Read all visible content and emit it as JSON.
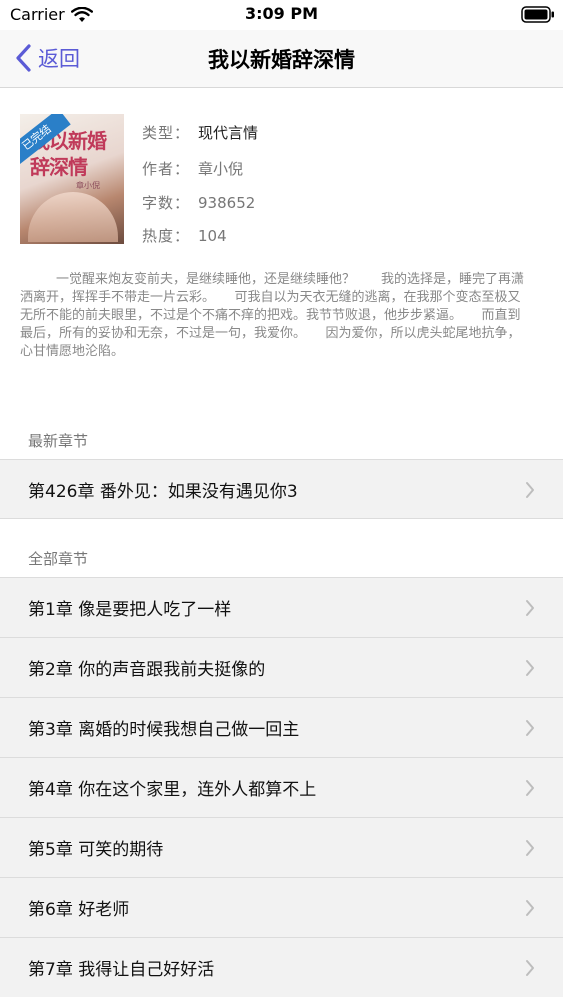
{
  "status_bar": {
    "carrier": "Carrier",
    "time": "3:09 PM"
  },
  "nav": {
    "back_label": "返回",
    "title": "我以新婚辞深情"
  },
  "book": {
    "cover_badge": "已完结",
    "cover_title": "我以新婚辞深情",
    "cover_author": "章小倪",
    "type_label": "类型：",
    "type_value": "现代言情",
    "author_label": "作者：",
    "author_value": "章小倪",
    "words_label": "字数：",
    "words_value": "938652",
    "hot_label": "热度：",
    "hot_value": "104",
    "summary": "一觉醒来炮友变前夫，是继续睡他，还是继续睡他？　　我的选择是，睡完了再潇洒离开，挥挥手不带走一片云彩。　　可我自以为天衣无缝的逃离，在我那个变态至极又无所不能的前夫眼里，不过是个不痛不痒的把戏。我节节败退，他步步紧逼。　　而直到最后，所有的妥协和无奈，不过是一句，我爱你。　　因为爱你，所以虎头蛇尾地抗争，心甘情愿地沦陷。"
  },
  "latest_section": {
    "title": "最新章节",
    "chapter": "第426章 番外见：如果没有遇见你3"
  },
  "all_section": {
    "title": "全部章节",
    "chapters": [
      "第1章 像是要把人吃了一样",
      "第2章 你的声音跟我前夫挺像的",
      "第3章 离婚的时候我想自己做一回主",
      "第4章 你在这个家里，连外人都算不上",
      "第5章 可笑的期待",
      "第6章 好老师",
      "第7章 我得让自己好好活"
    ]
  },
  "colors": {
    "accent": "#5b5bd6",
    "row_bg": "#f2f2f2"
  }
}
